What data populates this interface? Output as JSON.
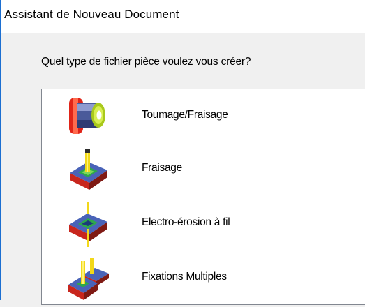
{
  "window": {
    "title": "Assistant de Nouveau Document"
  },
  "dialog": {
    "prompt": "Quel type de fichier pièce voulez vous créer?"
  },
  "file_types": [
    {
      "label": "Toumage/Fraisage",
      "icon": "turning-milling-icon"
    },
    {
      "label": "Fraisage",
      "icon": "milling-icon"
    },
    {
      "label": "Electro-érosion à fil",
      "icon": "wire-edm-icon"
    },
    {
      "label": "Fixations Multiples",
      "icon": "multiple-fixtures-icon"
    }
  ],
  "colors": {
    "window_border": "#1c6fd1",
    "dialog_background": "#f0f0f0",
    "list_background": "#ffffff",
    "list_border": "#828790"
  }
}
